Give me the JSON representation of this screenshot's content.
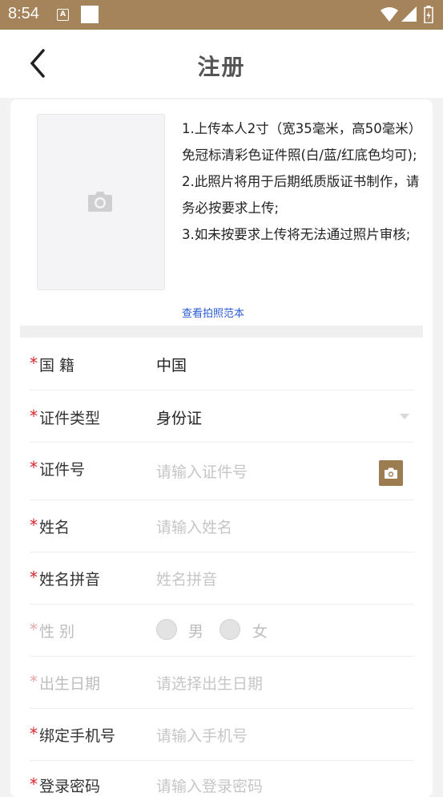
{
  "status_bar": {
    "time": "8:54",
    "notification_letter": "A"
  },
  "header": {
    "title": "注册"
  },
  "photo_instructions": {
    "lines": [
      "1.上传本人2寸（宽35毫米，高50毫米）免冠标清彩色证件照(白/蓝/红底色均可);",
      "2.此照片将用于后期纸质版证书制作，请务必按要求上传;",
      "3.如未按要求上传将无法通过照片审核;"
    ],
    "sample_link": "查看拍照范本"
  },
  "form": {
    "required_mark": "*",
    "nationality": {
      "label": "国  籍",
      "value": "中国"
    },
    "id_type": {
      "label": "证件类型",
      "value": "身份证"
    },
    "id_number": {
      "label": "证件号",
      "placeholder": "请输入证件号"
    },
    "name": {
      "label": "姓名",
      "placeholder": "请输入姓名"
    },
    "name_pinyin": {
      "label": "姓名拼音",
      "placeholder": "姓名拼音"
    },
    "gender": {
      "label": "性  别",
      "options": [
        "男",
        "女"
      ]
    },
    "birth_date": {
      "label": "出生日期",
      "placeholder": "请选择出生日期"
    },
    "phone": {
      "label": "绑定手机号",
      "placeholder": "请输入手机号"
    },
    "password": {
      "label": "登录密码",
      "placeholder": "请输入登录密码"
    }
  },
  "colors": {
    "status_bar": "#a5835b",
    "accent": "#9e7c52",
    "required": "#d9262c",
    "link": "#2a5bd7"
  }
}
